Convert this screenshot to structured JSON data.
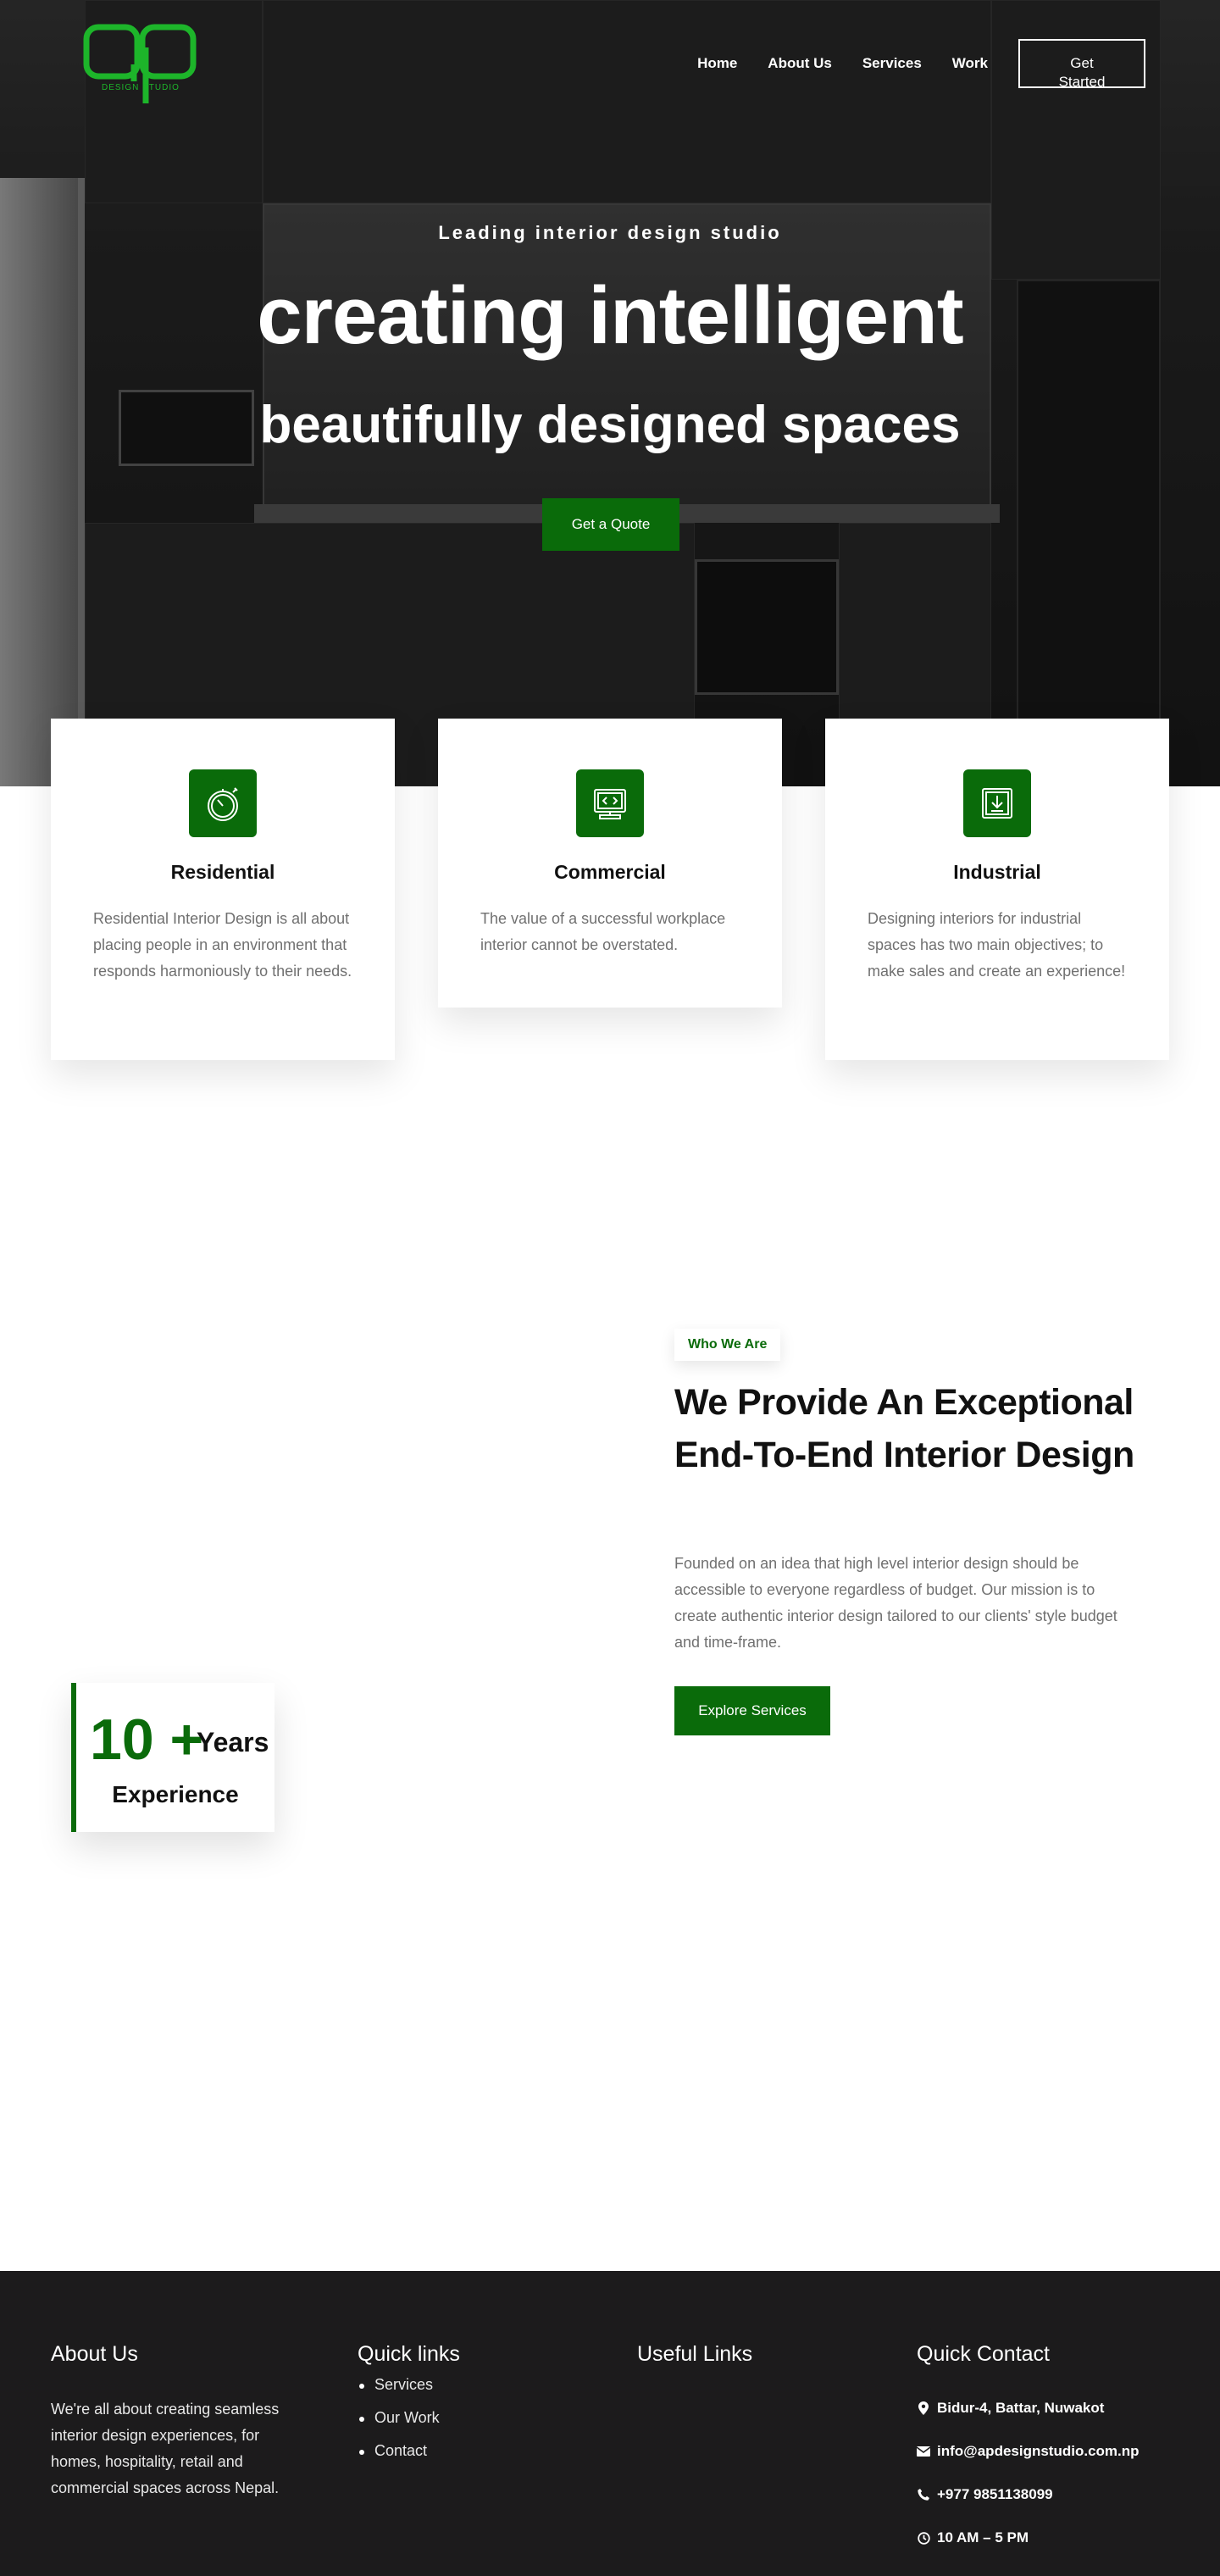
{
  "brand": {
    "logo_mark": "ap",
    "logo_sub": "DESIGN STUDIO",
    "accent": "#0a6b0a",
    "logo_color": "#1db52a"
  },
  "nav": {
    "items": [
      {
        "label": "Home"
      },
      {
        "label": "About Us"
      },
      {
        "label": "Services"
      },
      {
        "label": "Work"
      }
    ],
    "cta": "Get Started"
  },
  "hero": {
    "eyebrow": "Leading interior design studio",
    "headline": "creating intelligent",
    "subheadline": "beautifully designed spaces",
    "cta": "Get a Quote"
  },
  "services": [
    {
      "icon": "stopwatch-icon",
      "title": "Residential",
      "text": "Residential Interior Design is all about placing people in an environment that responds harmoniously to their needs."
    },
    {
      "icon": "monitor-code-icon",
      "title": "Commercial",
      "text": "The value of a successful workplace interior cannot be overstated."
    },
    {
      "icon": "download-box-icon",
      "title": "Industrial",
      "text": "Designing interiors for industrial spaces has two main objectives; to make sales and create an experience!"
    }
  ],
  "about": {
    "tag": "Who We Are",
    "heading": "We Provide An Exceptional End-To-End Interior Design",
    "text": "Founded on an idea that high level interior design should be accessible to everyone regardless of budget. Our mission is to create authentic interior design tailored to our clients' style budget and time-frame.",
    "cta": "Explore Services",
    "experience": {
      "number": "10 +",
      "unit": "Years",
      "label": "Experience"
    }
  },
  "footer": {
    "about": {
      "title": "About Us",
      "text": "We're all about creating seamless interior design experiences, for homes, hospitality, retail and commercial spaces across Nepal."
    },
    "quick_links": {
      "title": "Quick links",
      "items": [
        "Services",
        "Our Work",
        "Contact"
      ]
    },
    "useful_links": {
      "title": "Useful Links"
    },
    "contact": {
      "title": "Quick Contact",
      "address": "Bidur-4, Battar, Nuwakot",
      "email": "info@apdesignstudio.com.np",
      "phone": "+977 9851138099",
      "hours": "10 AM – 5 PM"
    }
  }
}
